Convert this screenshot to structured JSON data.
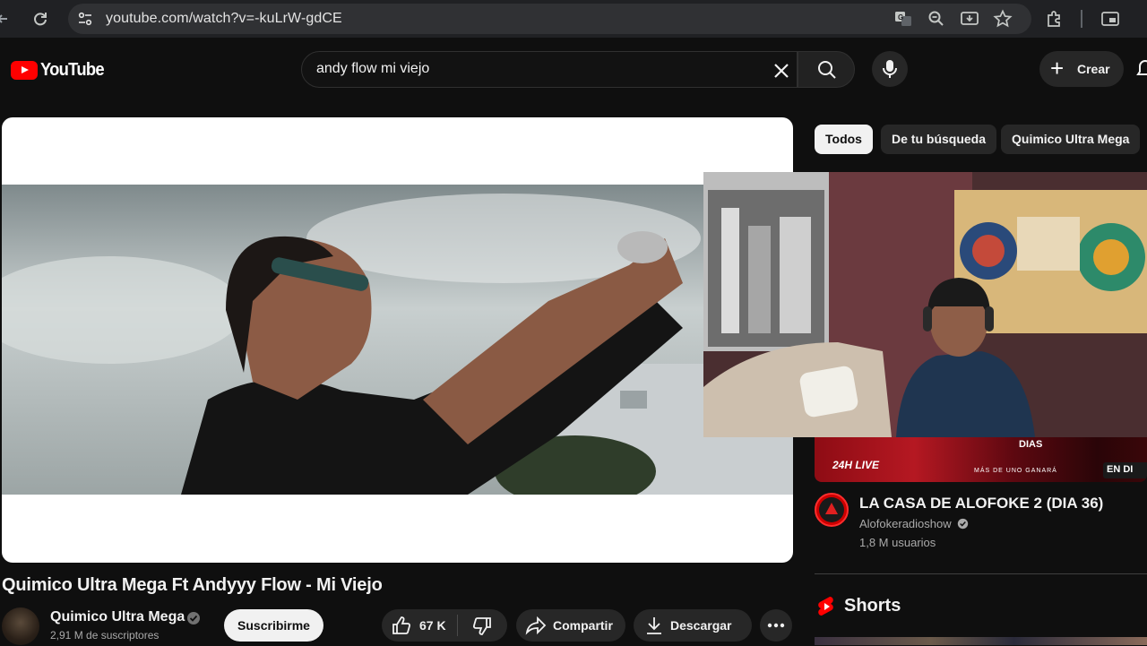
{
  "browser": {
    "url": "youtube.com/watch?v=-kuLrW-gdCE",
    "icons": [
      "back-icon",
      "reload-icon",
      "site-settings-icon",
      "translate-icon",
      "zoom-icon",
      "install-icon",
      "bookmark-star-icon",
      "extensions-icon",
      "split-view-icon"
    ]
  },
  "header": {
    "logo_text": "YouTube",
    "search_value": "andy flow mi viejo",
    "create_label": "Crear"
  },
  "video": {
    "title": "Quimico Ultra Mega Ft Andyyy Flow - Mi Viejo",
    "channel": "Quimico Ultra Mega",
    "subscribers": "2,91 M de suscriptores",
    "subscribe_label": "Suscribirme",
    "likes": "67 K",
    "share_label": "Compartir",
    "download_label": "Descargar"
  },
  "sidebar": {
    "chips": [
      {
        "label": "Todos",
        "active": true
      },
      {
        "label": "De tu búsqueda",
        "active": false
      },
      {
        "label": "Quimico Ultra Mega",
        "active": false
      }
    ],
    "live_item": {
      "thumb_badge": "24H LIVE",
      "thumb_live": "EN DI",
      "thumb_days": "DIAS",
      "thumb_tagline": "MÁS DE UNO GANARÁ",
      "title": "LA CASA DE ALOFOKE 2 (DIA 36)",
      "channel": "Alofokeradioshow",
      "viewers": "1,8 M usuarios"
    },
    "shorts_label": "Shorts"
  },
  "colors": {
    "background": "#0f0f0f",
    "accent_red": "#ff0000",
    "chip_bg": "#272727"
  }
}
